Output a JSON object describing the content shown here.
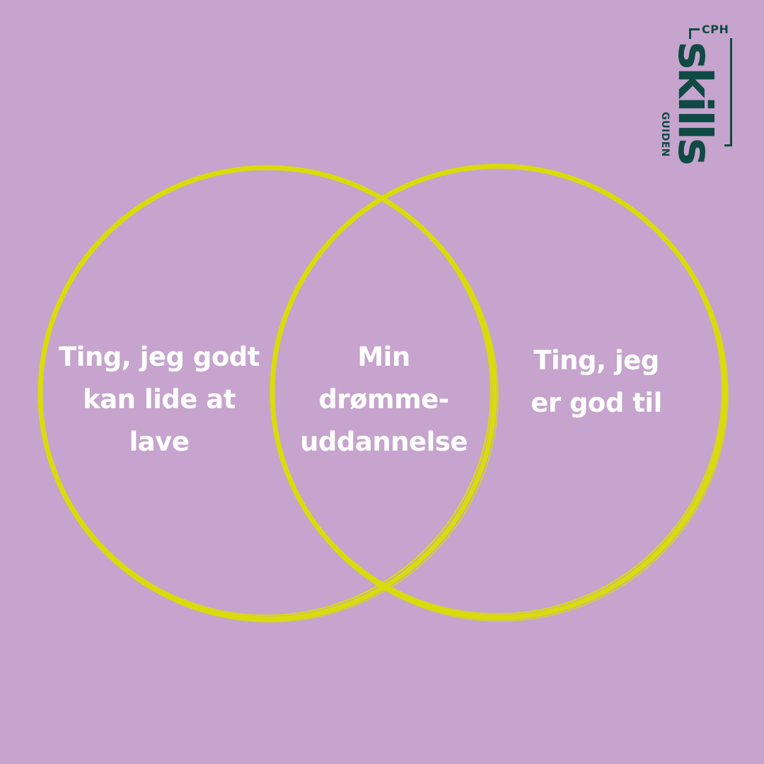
{
  "colors": {
    "background": "#c6a4cd",
    "circle_stroke": "#d9dc0a",
    "label_text": "#ffffff",
    "logo": "#0f4a45"
  },
  "venn": {
    "left_label": "Ting, jeg godt\nkan lide at\nlave",
    "middle_label": "Min\ndrømme-\nuddannelse",
    "right_label": "Ting, jeg\ner god til"
  },
  "logo": {
    "prefix": "CPH",
    "wordmark": "skills",
    "suffix": "GUIDEN"
  }
}
